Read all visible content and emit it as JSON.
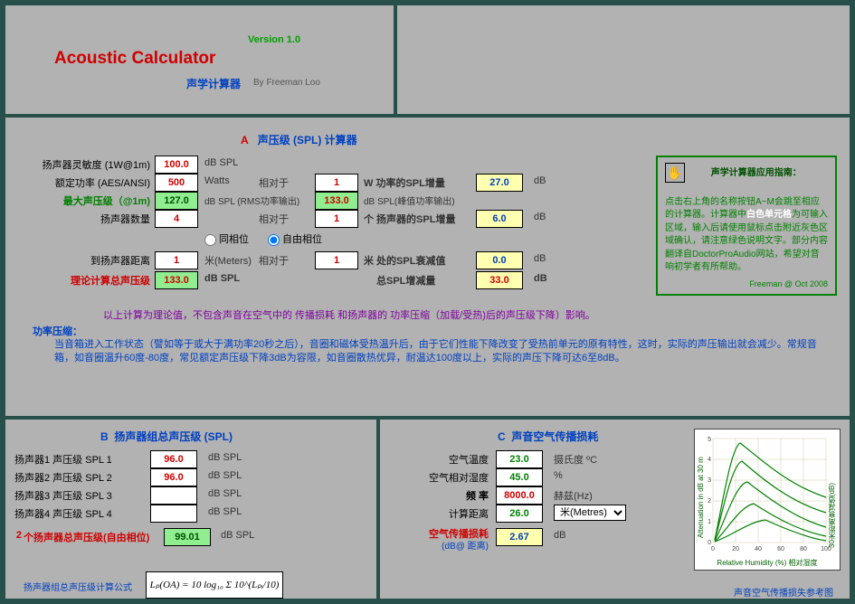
{
  "header": {
    "version": "Version  1.0",
    "titleEn": "Acoustic   Calculator",
    "titleCn": "声学计算器",
    "by": "By   Freeman Loo"
  },
  "secA": {
    "letter": "A",
    "titleCn": "声压级 (SPL) 计算器",
    "sensitivity_lbl": "扬声器灵敏度 (1W@1m)",
    "sensitivity_val": "100.0",
    "sens_unit": "dB SPL",
    "ratedP_lbl": "额定功率 (AES/ANSI)",
    "ratedP_val": "500",
    "ratedP_unit": "Watts",
    "rel1": "相对于",
    "refW_val": "1",
    "refW_txt": "W 功率的SPL增量",
    "gainW_val": "27.0",
    "gainW_unit": "dB",
    "maxSPL_lbl": "最大声压级（@1m)",
    "maxSPL_val": "127.0",
    "maxSPL_unit": "dB SPL (RMS功率输出)",
    "peakSPL_val": "133.0",
    "peakSPL_unit": "dB SPL(峰值功率输出)",
    "qty_lbl": "扬声器数量",
    "qty_val": "4",
    "rel2": "相对于",
    "refQty_val": "1",
    "refQty_txt": "个 扬声器的SPL增量",
    "gainQ_val": "6.0",
    "gainQ_unit": "dB",
    "phase_same": "同相位",
    "phase_free": "自由相位",
    "dist_lbl": "到扬声器距离",
    "dist_val": "1",
    "dist_unit": "米(Meters)",
    "rel3": "相对于",
    "refD_val": "1",
    "refD_txt": "米 处的SPL衰减值",
    "attD_val": "0.0",
    "attD_unit": "dB",
    "theo_lbl": "理论计算总声压级",
    "theo_val": "133.0",
    "theo_unit": "dB SPL",
    "totGain_lbl": "总SPL增减量",
    "totGain_val": "33.0",
    "totGain_unit": "dB",
    "noteMagenta": "以上计算为理论值，不包含声音在空气中的 传播损耗 和扬声器的 功率压缩（加载/受热)后的声压级下降）影响。",
    "pc_title": "功率压缩：",
    "pc_body": "当音箱进入工作状态（譬如等于或大于满功率20秒之后），音圈和磁体受热温升后，由于它们性能下降改变了受热前单元的原有特性，这时，实际的声压输出就会减少。常规音箱，如音圈温升60度-80度，常见额定声压级下降3dB为容限，如音圈散热优异，耐温达100度以上，实际的声压下降可达6至8dB。"
  },
  "guide": {
    "title": "声学计算器应用指南：",
    "body1": "点击右上角的名称按钮A~M会跳至相应的计算器。计算器中",
    "white": "白色单元格",
    "body2": "为可输入区域，输入后请使用鼠标点击附近灰色区域确认，请注意绿色说明文字。部分内容翻译自DoctorProAudio网站，希望对音响初学者有所帮助。",
    "sig": "Freeman @ Oct  2008"
  },
  "secB": {
    "letter": "B",
    "title": "扬声器组总声压级 (SPL)",
    "row1_lbl": "扬声器1 声压级  SPL 1",
    "row1_val": "96.0",
    "row2_lbl": "扬声器2 声压级  SPL 2",
    "row2_val": "96.0",
    "row3_lbl": "扬声器3 声压级  SPL 3",
    "row3_val": "",
    "row4_lbl": "扬声器4 声压级  SPL 4",
    "row4_val": "",
    "unit": "dB SPL",
    "tot_count": "2",
    "tot_lbl": "个扬声器总声压级(自由相位)",
    "tot_val": "99.01",
    "tot_unit": "dB SPL",
    "formula_lbl": "扬声器组总声压级计算公式",
    "formula": "Lₚ(OA) = 10 log₁₀ Σ 10^(Lₚᵢ/10)"
  },
  "secC": {
    "letter": "C",
    "title": "声音空气传播损耗",
    "temp_lbl": "空气温度",
    "temp_val": "23.0",
    "temp_unit": "摄氏度  ºC",
    "hum_lbl": "空气相对湿度",
    "hum_val": "45.0",
    "hum_unit": "%",
    "freq_lbl": "频  率",
    "freq_val": "8000.0",
    "freq_unit": "赫兹(Hz)",
    "dist_lbl": "计算距离",
    "dist_val": "26.0",
    "dist_sel": "米(Metres)",
    "loss_lbl": "空气传播损耗",
    "loss_sub": "(dB@ 距离)",
    "loss_val": "2.67",
    "loss_unit": "dB",
    "chart_x": "Relative Humidity (%) 相对湿度",
    "chart_y1": "30米距离衰减值(dB)",
    "chart_y2": "Attenuation in dB at 30 m",
    "chart_caption": "声音空气传播损失参考图"
  }
}
